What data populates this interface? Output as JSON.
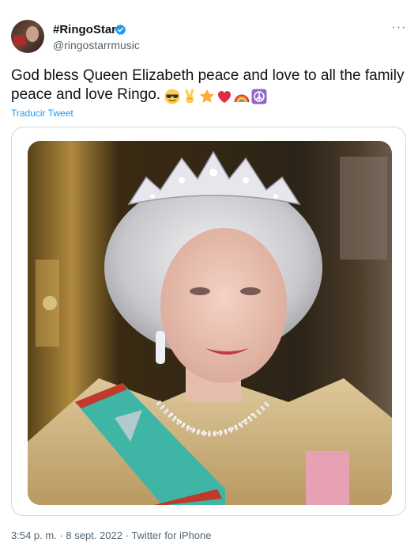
{
  "tweet": {
    "display_name": "#RingoStarr",
    "verified": true,
    "handle": "@ringostarrmusic",
    "text": "God bless Queen Elizabeth peace and love to all the family peace and love Ringo.",
    "emojis": [
      "sunglasses-face",
      "victory-hand",
      "star",
      "red-heart",
      "rainbow",
      "peace-symbol"
    ],
    "translate_label": "Traducir Tweet",
    "time": "3:54 p. m.",
    "separator": "·",
    "date": "8 sept. 2022",
    "source": "Twitter for iPhone"
  },
  "colors": {
    "accent": "#1d9bf0",
    "text_primary": "#0f1419",
    "text_secondary": "#536471",
    "border": "#cfd9de"
  }
}
